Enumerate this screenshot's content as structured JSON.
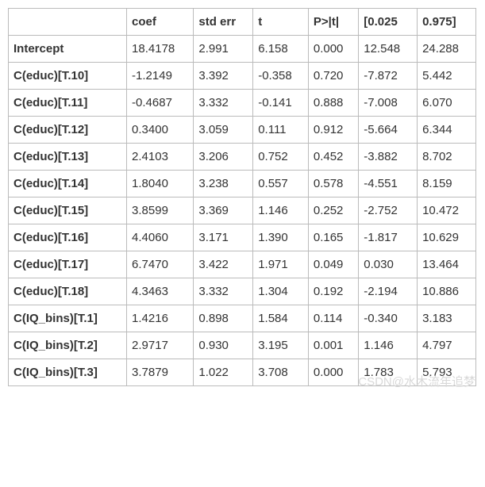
{
  "headers": [
    "",
    "coef",
    "std err",
    "t",
    "P>|t|",
    "[0.025",
    "0.975]"
  ],
  "rows": [
    {
      "label": "Intercept",
      "coef": "18.4178",
      "stderr": "2.991",
      "t": "6.158",
      "p": "0.000",
      "lo": "12.548",
      "hi": "24.288"
    },
    {
      "label": "C(educ)[T.10]",
      "coef": "-1.2149",
      "stderr": "3.392",
      "t": "-0.358",
      "p": "0.720",
      "lo": "-7.872",
      "hi": "5.442"
    },
    {
      "label": "C(educ)[T.11]",
      "coef": "-0.4687",
      "stderr": "3.332",
      "t": "-0.141",
      "p": "0.888",
      "lo": "-7.008",
      "hi": "6.070"
    },
    {
      "label": "C(educ)[T.12]",
      "coef": "0.3400",
      "stderr": "3.059",
      "t": "0.111",
      "p": "0.912",
      "lo": "-5.664",
      "hi": "6.344"
    },
    {
      "label": "C(educ)[T.13]",
      "coef": "2.4103",
      "stderr": "3.206",
      "t": "0.752",
      "p": "0.452",
      "lo": "-3.882",
      "hi": "8.702"
    },
    {
      "label": "C(educ)[T.14]",
      "coef": "1.8040",
      "stderr": "3.238",
      "t": "0.557",
      "p": "0.578",
      "lo": "-4.551",
      "hi": "8.159"
    },
    {
      "label": "C(educ)[T.15]",
      "coef": "3.8599",
      "stderr": "3.369",
      "t": "1.146",
      "p": "0.252",
      "lo": "-2.752",
      "hi": "10.472"
    },
    {
      "label": "C(educ)[T.16]",
      "coef": "4.4060",
      "stderr": "3.171",
      "t": "1.390",
      "p": "0.165",
      "lo": "-1.817",
      "hi": "10.629"
    },
    {
      "label": "C(educ)[T.17]",
      "coef": "6.7470",
      "stderr": "3.422",
      "t": "1.971",
      "p": "0.049",
      "lo": "0.030",
      "hi": "13.464"
    },
    {
      "label": "C(educ)[T.18]",
      "coef": "4.3463",
      "stderr": "3.332",
      "t": "1.304",
      "p": "0.192",
      "lo": "-2.194",
      "hi": "10.886"
    },
    {
      "label": "C(IQ_bins)[T.1]",
      "coef": "1.4216",
      "stderr": "0.898",
      "t": "1.584",
      "p": "0.114",
      "lo": "-0.340",
      "hi": "3.183"
    },
    {
      "label": "C(IQ_bins)[T.2]",
      "coef": "2.9717",
      "stderr": "0.930",
      "t": "3.195",
      "p": "0.001",
      "lo": "1.146",
      "hi": "4.797"
    },
    {
      "label": "C(IQ_bins)[T.3]",
      "coef": "3.7879",
      "stderr": "1.022",
      "t": "3.708",
      "p": "0.000",
      "lo": "1.783",
      "hi": "5.793"
    }
  ],
  "watermark": "CSDN@水木流年追梦"
}
